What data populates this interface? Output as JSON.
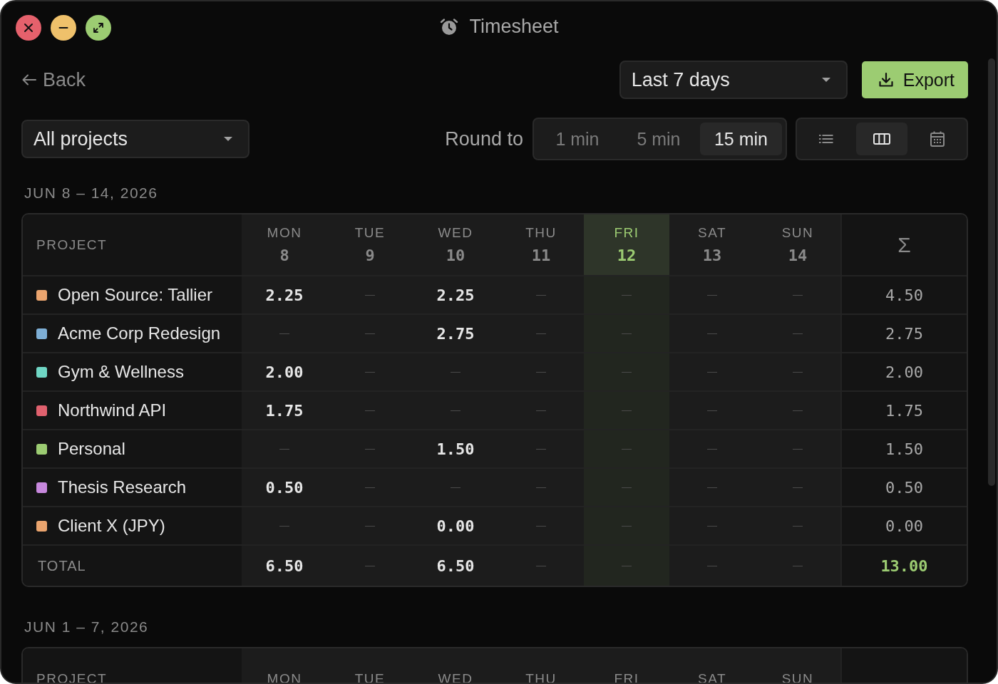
{
  "window": {
    "title": "Timesheet",
    "controls": [
      {
        "kind": "close"
      },
      {
        "kind": "minimize"
      },
      {
        "kind": "maximize"
      }
    ]
  },
  "back": {
    "label": "Back"
  },
  "range": {
    "value": "Last 7 days"
  },
  "export": {
    "label": "Export"
  },
  "project_filter": {
    "value": "All projects"
  },
  "round_to": {
    "label": "Round to",
    "options": [
      {
        "label": "1 min",
        "selected": false
      },
      {
        "label": "5 min",
        "selected": false
      },
      {
        "label": "15 min",
        "selected": true
      }
    ]
  },
  "views": [
    {
      "kind": "list",
      "selected": false
    },
    {
      "kind": "columns",
      "selected": true
    },
    {
      "kind": "calendar",
      "selected": false
    }
  ],
  "weeks": [
    {
      "label": "JUN 8 – 14, 2026",
      "project_header": "PROJECT",
      "sum_header": "Σ",
      "days": [
        {
          "day": "MON",
          "date": "8",
          "selected": false
        },
        {
          "day": "TUE",
          "date": "9",
          "selected": false
        },
        {
          "day": "WED",
          "date": "10",
          "selected": false
        },
        {
          "day": "THU",
          "date": "11",
          "selected": false
        },
        {
          "day": "FRI",
          "date": "12",
          "selected": true
        },
        {
          "day": "SAT",
          "date": "13",
          "selected": false
        },
        {
          "day": "SUN",
          "date": "14",
          "selected": false
        }
      ],
      "rows": [
        {
          "name": "Open Source: Tallier",
          "color": "#eaa46e",
          "cells": [
            "2.25",
            null,
            "2.25",
            null,
            null,
            null,
            null
          ],
          "total": "4.50"
        },
        {
          "name": "Acme Corp Redesign",
          "color": "#7eafd6",
          "cells": [
            null,
            null,
            "2.75",
            null,
            null,
            null,
            null
          ],
          "total": "2.75"
        },
        {
          "name": "Gym & Wellness",
          "color": "#6fd6c4",
          "cells": [
            "2.00",
            null,
            null,
            null,
            null,
            null,
            null
          ],
          "total": "2.00"
        },
        {
          "name": "Northwind API",
          "color": "#e0616e",
          "cells": [
            "1.75",
            null,
            null,
            null,
            null,
            null,
            null
          ],
          "total": "1.75"
        },
        {
          "name": "Personal",
          "color": "#9ccc72",
          "cells": [
            null,
            null,
            "1.50",
            null,
            null,
            null,
            null
          ],
          "total": "1.50"
        },
        {
          "name": "Thesis Research",
          "color": "#c788dd",
          "cells": [
            "0.50",
            null,
            null,
            null,
            null,
            null,
            null
          ],
          "total": "0.50"
        },
        {
          "name": "Client X (JPY)",
          "color": "#eaa46e",
          "cells": [
            null,
            null,
            "0.00",
            null,
            null,
            null,
            null
          ],
          "total": "0.00"
        }
      ],
      "total": {
        "label": "TOTAL",
        "cells": [
          "6.50",
          null,
          "6.50",
          null,
          null,
          null,
          null
        ],
        "total": "13.00"
      }
    },
    {
      "label": "JUN 1 – 7, 2026",
      "project_header": "PROJECT",
      "days": [
        {
          "day": "MON",
          "selected": false
        },
        {
          "day": "TUE",
          "selected": false
        },
        {
          "day": "WED",
          "selected": false
        },
        {
          "day": "THU",
          "selected": false
        },
        {
          "day": "FRI",
          "selected": false
        },
        {
          "day": "SAT",
          "selected": false
        },
        {
          "day": "SUN",
          "selected": false
        }
      ]
    }
  ]
}
